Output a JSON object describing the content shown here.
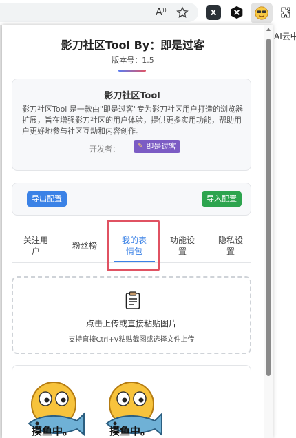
{
  "browser": {
    "icons": [
      "read-aloud-icon",
      "favorite-star-icon",
      "x-extension-icon",
      "hex-extension-icon",
      "cool-emoji-extension-icon",
      "extensions-puzzle-icon"
    ],
    "read_aloud_label": "A",
    "background_text": "AI云中"
  },
  "header": {
    "title": "影刀社区Tool By：即是过客",
    "version": "版本号：1.5"
  },
  "info": {
    "title": "影刀社区Tool",
    "description": "影刀社区Tool 是一款由\"即是过客\"专为影刀社区用户打造的浏览器扩展，旨在增强影刀社区的用户体验，提供更多实用功能，帮助用户更好地参与社区互动和内容创作。",
    "developer_label": "开发者：",
    "developer_name": "即是过客"
  },
  "config": {
    "export_label": "导出配置",
    "import_label": "导入配置"
  },
  "tabs": [
    {
      "label": "关注用户",
      "active": false
    },
    {
      "label": "粉丝榜",
      "active": false
    },
    {
      "label": "我的表情包",
      "active": true
    },
    {
      "label": "功能设置",
      "active": false
    },
    {
      "label": "隐私设置",
      "active": false
    }
  ],
  "upload": {
    "main_text": "点击上传或直接粘贴图片",
    "sub_text": "支持直接Ctrl+V粘贴截图或选择文件上传"
  },
  "emojis": [
    {
      "caption": "摸鱼中。"
    },
    {
      "caption": "摸鱼中。"
    }
  ],
  "colors": {
    "primary": "#3b82e6",
    "success": "#2da44e",
    "developer_badge": "#7c5cc4",
    "highlight": "#e05262"
  }
}
